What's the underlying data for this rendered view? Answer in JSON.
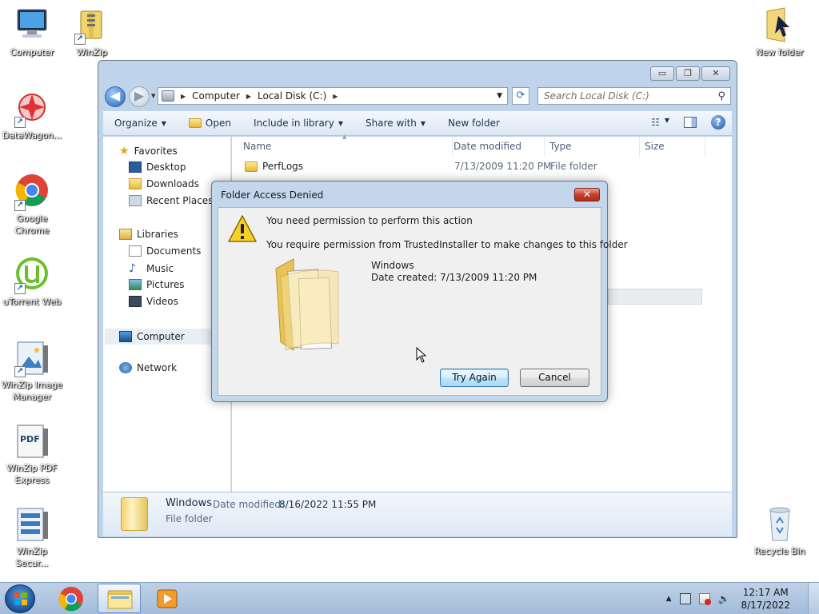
{
  "desktop": {
    "icons": [
      {
        "label": "Computer",
        "name": "computer-desktop-icon"
      },
      {
        "label": "WinZip",
        "name": "winzip-desktop-icon"
      },
      {
        "label": "New folder",
        "name": "new-folder-desktop-icon"
      },
      {
        "label": "DataWagon...",
        "name": "datawagon-desktop-icon"
      },
      {
        "label": "Google Chrome",
        "name": "google-chrome-desktop-icon"
      },
      {
        "label": "uTorrent Web",
        "name": "utorrent-web-desktop-icon"
      },
      {
        "label": "WinZip Image Manager",
        "name": "winzip-image-manager-desktop-icon"
      },
      {
        "label": "WinZip PDF Express",
        "name": "winzip-pdf-express-desktop-icon"
      },
      {
        "label": "WinZip Secur...",
        "name": "winzip-secure-desktop-icon"
      },
      {
        "label": "Recycle Bin",
        "name": "recycle-bin-desktop-icon"
      }
    ],
    "pdf_badge": "PDF"
  },
  "explorer": {
    "window_controls": {
      "minimize": "▭",
      "maximize": "❐",
      "close": "✕"
    },
    "nav": {
      "back": "◀",
      "forward": "▶"
    },
    "address": {
      "crumbs": [
        "Computer",
        "Local Disk (C:)"
      ],
      "sep": "▶",
      "dropdown": "▼",
      "refresh": "⟳"
    },
    "search": {
      "placeholder": "Search Local Disk (C:)",
      "icon": "⚲"
    },
    "toolbar": {
      "organize": "Organize",
      "open": "Open",
      "include_in_library": "Include in library",
      "share_with": "Share with",
      "new_folder": "New folder",
      "dropdown_arrow": "▼",
      "views_icon": "☷",
      "help_label": "?"
    },
    "nav_pane": {
      "favorites": "Favorites",
      "desktop": "Desktop",
      "downloads": "Downloads",
      "recent_places": "Recent Places",
      "libraries": "Libraries",
      "documents": "Documents",
      "music": "Music",
      "pictures": "Pictures",
      "videos": "Videos",
      "computer": "Computer",
      "network": "Network"
    },
    "columns": {
      "name": "Name",
      "date_modified": "Date modified",
      "type": "Type",
      "size": "Size"
    },
    "rows": [
      {
        "name": "PerfLogs",
        "date_modified": "7/13/2009 11:20 PM",
        "type": "File folder"
      }
    ],
    "details": {
      "name": "Windows",
      "date_label": "Date modified:",
      "date_value": "8/16/2022 11:55 PM",
      "type": "File folder"
    }
  },
  "dialog": {
    "title": "Folder Access Denied",
    "close": "✕",
    "message_main": "You need permission to perform this action",
    "message_detail": "You require permission from TrustedInstaller to make changes to this folder",
    "item_name": "Windows",
    "item_date": "Date created: 7/13/2009 11:20 PM",
    "try_again": "Try Again",
    "cancel": "Cancel"
  },
  "taskbar": {
    "show_hidden_icons": "▲",
    "volume": "🔊",
    "time": "12:17 AM",
    "date": "8/17/2022"
  },
  "colors": {
    "window_frame": "#bfd4ea",
    "dialog_frame": "#c3d6ec",
    "close_red": "#c4402a",
    "taskbar": "#a3bcd9"
  }
}
